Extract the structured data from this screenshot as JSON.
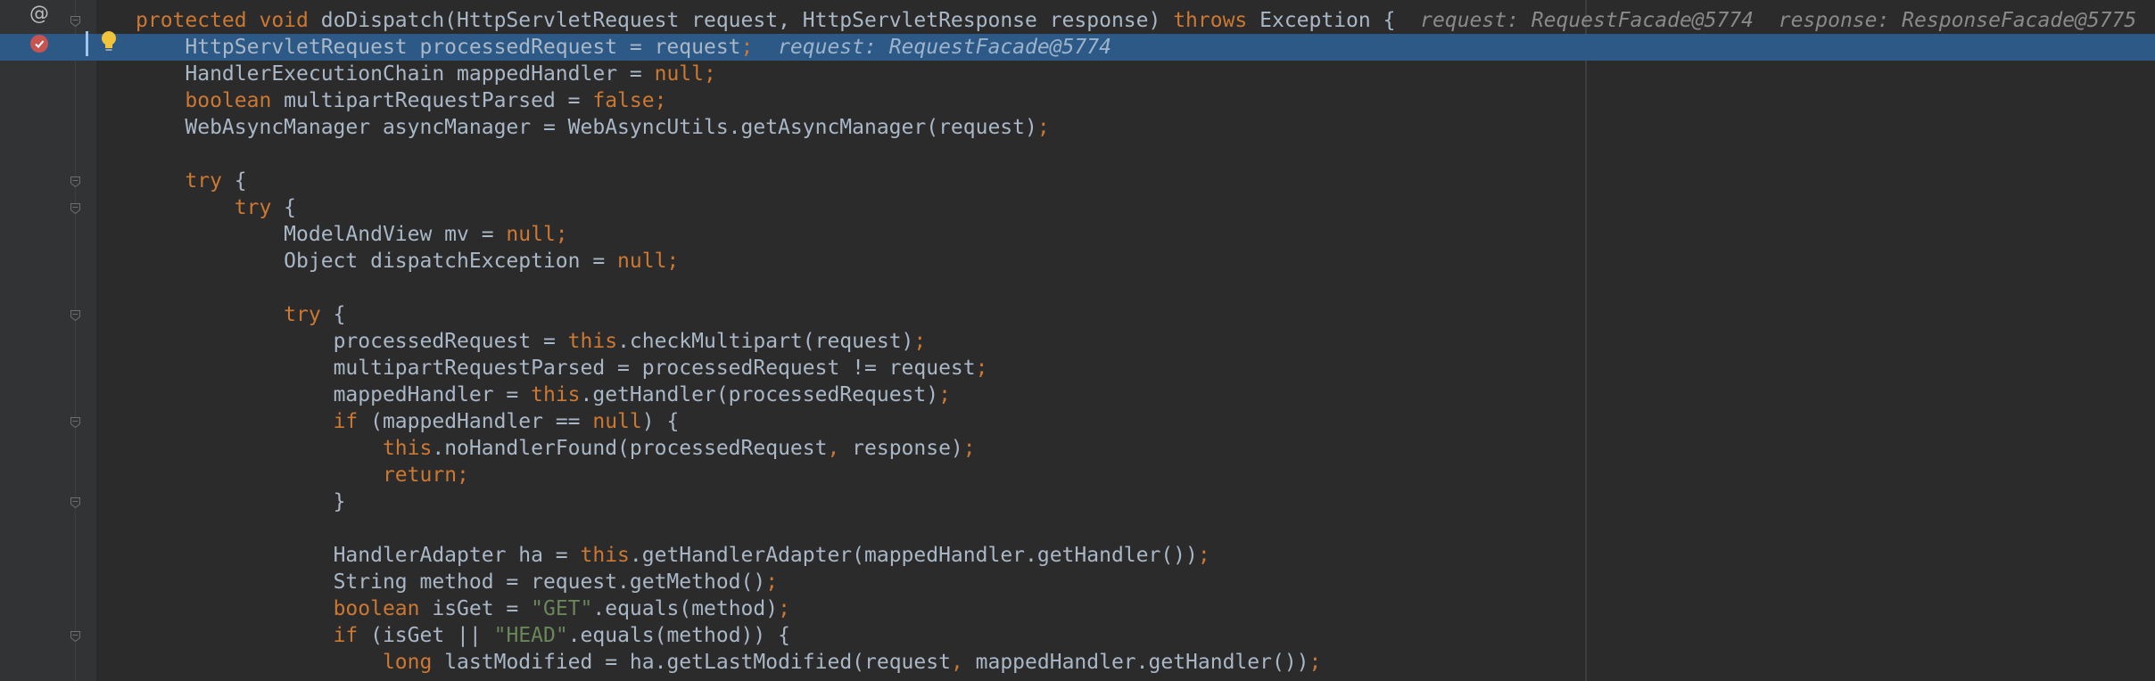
{
  "editor": {
    "lines": [
      {
        "indent": "",
        "segments": [
          {
            "t": "protected void ",
            "c": "kw"
          },
          {
            "t": "doDispatch(HttpServletRequest request, HttpServletResponse response) ",
            "c": ""
          },
          {
            "t": "throws ",
            "c": "kw"
          },
          {
            "t": "Exception {",
            "c": ""
          },
          {
            "t": "  request: RequestFacade@5774  response: ResponseFacade@5775",
            "c": "inlay"
          }
        ],
        "fold": true
      },
      {
        "indent": "    ",
        "current": true,
        "segments": [
          {
            "t": "HttpServletRequest processedRequest = request",
            "c": ""
          },
          {
            "t": ";",
            "c": "kw"
          },
          {
            "t": "  request: RequestFacade@5774",
            "c": "inlay-cur"
          }
        ]
      },
      {
        "indent": "    ",
        "segments": [
          {
            "t": "HandlerExecutionChain mappedHandler = ",
            "c": ""
          },
          {
            "t": "null;",
            "c": "kw"
          }
        ]
      },
      {
        "indent": "    ",
        "segments": [
          {
            "t": "boolean ",
            "c": "kw"
          },
          {
            "t": "multipartRequestParsed = ",
            "c": ""
          },
          {
            "t": "false;",
            "c": "kw"
          }
        ]
      },
      {
        "indent": "    ",
        "segments": [
          {
            "t": "WebAsyncManager asyncManager = WebAsyncUtils.getAsyncManager(request)",
            "c": ""
          },
          {
            "t": ";",
            "c": "kw"
          }
        ]
      },
      {
        "indent": "",
        "segments": []
      },
      {
        "indent": "    ",
        "segments": [
          {
            "t": "try ",
            "c": "kw"
          },
          {
            "t": "{",
            "c": ""
          }
        ],
        "fold": true
      },
      {
        "indent": "        ",
        "segments": [
          {
            "t": "try ",
            "c": "kw"
          },
          {
            "t": "{",
            "c": ""
          }
        ],
        "fold": true
      },
      {
        "indent": "            ",
        "segments": [
          {
            "t": "ModelAndView mv = ",
            "c": ""
          },
          {
            "t": "null;",
            "c": "kw"
          }
        ]
      },
      {
        "indent": "            ",
        "segments": [
          {
            "t": "Object dispatchException = ",
            "c": ""
          },
          {
            "t": "null;",
            "c": "kw"
          }
        ]
      },
      {
        "indent": "",
        "segments": []
      },
      {
        "indent": "            ",
        "segments": [
          {
            "t": "try ",
            "c": "kw"
          },
          {
            "t": "{",
            "c": ""
          }
        ],
        "fold": true
      },
      {
        "indent": "                ",
        "segments": [
          {
            "t": "processedRequest = ",
            "c": ""
          },
          {
            "t": "this",
            "c": "kw"
          },
          {
            "t": ".checkMultipart(request)",
            "c": ""
          },
          {
            "t": ";",
            "c": "kw"
          }
        ]
      },
      {
        "indent": "                ",
        "segments": [
          {
            "t": "multipartRequestParsed = processedRequest != request",
            "c": ""
          },
          {
            "t": ";",
            "c": "kw"
          }
        ]
      },
      {
        "indent": "                ",
        "segments": [
          {
            "t": "mappedHandler = ",
            "c": ""
          },
          {
            "t": "this",
            "c": "kw"
          },
          {
            "t": ".getHandler(processedRequest)",
            "c": ""
          },
          {
            "t": ";",
            "c": "kw"
          }
        ]
      },
      {
        "indent": "                ",
        "segments": [
          {
            "t": "if ",
            "c": "kw"
          },
          {
            "t": "(mappedHandler == ",
            "c": ""
          },
          {
            "t": "null",
            "c": "kw"
          },
          {
            "t": ") {",
            "c": ""
          }
        ],
        "fold": true
      },
      {
        "indent": "                    ",
        "segments": [
          {
            "t": "this",
            "c": "kw"
          },
          {
            "t": ".noHandlerFound(processedRequest",
            "c": ""
          },
          {
            "t": ", ",
            "c": "kw"
          },
          {
            "t": "response)",
            "c": ""
          },
          {
            "t": ";",
            "c": "kw"
          }
        ]
      },
      {
        "indent": "                    ",
        "segments": [
          {
            "t": "return;",
            "c": "kw"
          }
        ]
      },
      {
        "indent": "                ",
        "segments": [
          {
            "t": "}",
            "c": ""
          }
        ],
        "fold": true
      },
      {
        "indent": "",
        "segments": []
      },
      {
        "indent": "                ",
        "segments": [
          {
            "t": "HandlerAdapter ha = ",
            "c": ""
          },
          {
            "t": "this",
            "c": "kw"
          },
          {
            "t": ".getHandlerAdapter(mappedHandler.getHandler())",
            "c": ""
          },
          {
            "t": ";",
            "c": "kw"
          }
        ]
      },
      {
        "indent": "                ",
        "segments": [
          {
            "t": "String method = request.getMethod()",
            "c": ""
          },
          {
            "t": ";",
            "c": "kw"
          }
        ]
      },
      {
        "indent": "                ",
        "segments": [
          {
            "t": "boolean ",
            "c": "kw"
          },
          {
            "t": "isGet = ",
            "c": ""
          },
          {
            "t": "\"GET\"",
            "c": "str"
          },
          {
            "t": ".equals(method)",
            "c": ""
          },
          {
            "t": ";",
            "c": "kw"
          }
        ]
      },
      {
        "indent": "                ",
        "segments": [
          {
            "t": "if ",
            "c": "kw"
          },
          {
            "t": "(isGet || ",
            "c": ""
          },
          {
            "t": "\"HEAD\"",
            "c": "str"
          },
          {
            "t": ".equals(method)) {",
            "c": ""
          }
        ],
        "fold": true
      },
      {
        "indent": "                    ",
        "segments": [
          {
            "t": "long ",
            "c": "kw"
          },
          {
            "t": "lastModified = ha.getLastModified(request",
            "c": ""
          },
          {
            "t": ", ",
            "c": "kw"
          },
          {
            "t": "mappedHandler.getHandler())",
            "c": ""
          },
          {
            "t": ";",
            "c": "kw"
          }
        ]
      },
      {
        "indent": "",
        "segments": []
      }
    ]
  },
  "colors": {
    "background": "#2b2b2b",
    "current_line": "#2d5986",
    "keyword": "#cc7832",
    "string": "#6a8759",
    "text": "#a9b7c6"
  },
  "gutter_icons": {
    "override": "@",
    "breakpoint": "breakpoint-icon",
    "intention": "lightbulb-icon"
  }
}
